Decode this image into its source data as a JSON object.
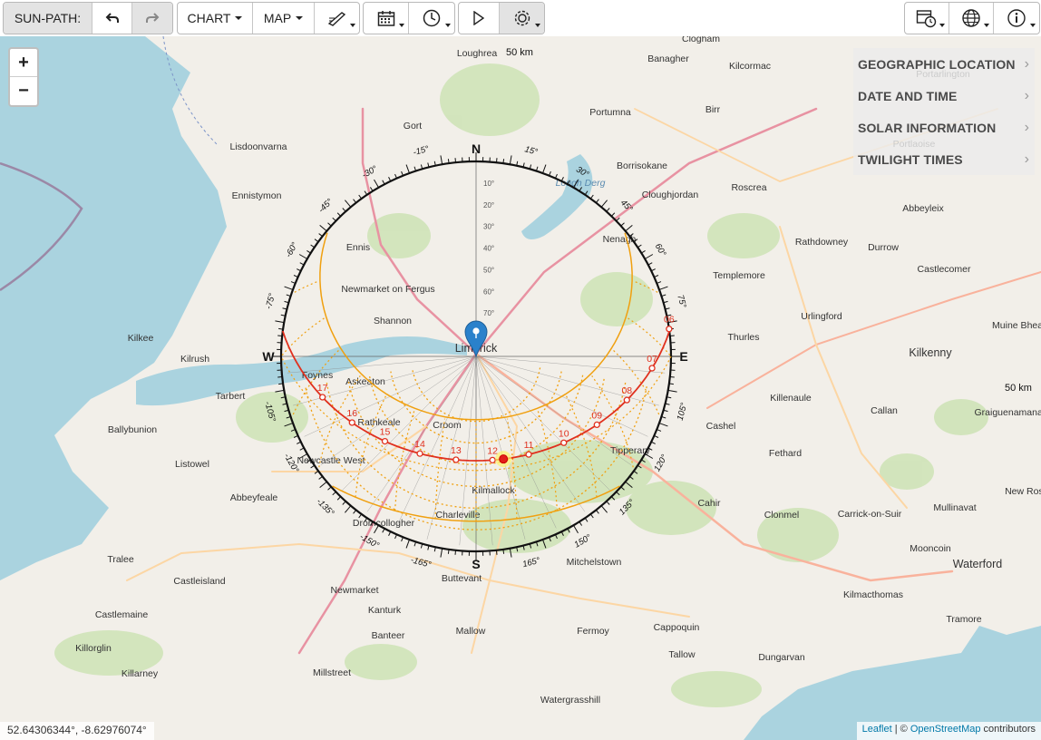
{
  "toolbar": {
    "app_label": "SUN-PATH:",
    "chart_label": "CHART",
    "map_label": "MAP",
    "icons": [
      "undo-icon",
      "redo-icon",
      "draw-icon",
      "calendar-icon",
      "clock-icon",
      "play-icon",
      "settings-icon",
      "datetime-settings-icon",
      "globe-icon",
      "info-icon"
    ]
  },
  "zoom": {
    "in": "+",
    "out": "−"
  },
  "panel": {
    "items": [
      {
        "label": "GEOGRAPHIC LOCATION"
      },
      {
        "label": "DATE AND TIME"
      },
      {
        "label": "SOLAR INFORMATION"
      },
      {
        "label": "TWILIGHT TIMES"
      }
    ],
    "chevron": "›"
  },
  "compass": {
    "north": "N",
    "south": "S",
    "east": "E",
    "west": "W",
    "azimuth_labels": [
      "15°",
      "30°",
      "45°",
      "60°",
      "75°",
      "105°",
      "120°",
      "135°",
      "150°",
      "165°",
      "-15°",
      "-30°",
      "-45°",
      "-60°",
      "-75°",
      "-105°",
      "-120°",
      "-135°",
      "-150°",
      "-165°"
    ],
    "altitude_labels": [
      "10°",
      "20°",
      "30°",
      "40°",
      "50°",
      "60°",
      "70°"
    ]
  },
  "sun_path": {
    "hours": [
      "17",
      "16",
      "15",
      "14",
      "13",
      "12",
      "11",
      "10",
      "09",
      "08",
      "07",
      "06"
    ],
    "color": "#e0301e",
    "arc_color": "#f0a010"
  },
  "map": {
    "places": [
      "Loughrea",
      "Banagher",
      "Kilcormac",
      "Clogham",
      "Portarlington",
      "Gort",
      "Portumna",
      "Birr",
      "Lisdoonvarna",
      "Borrisokane",
      "Roscrea",
      "Portlaoise",
      "Ennistymon",
      "Cloughjordan",
      "Abbeyleix",
      "Ennis",
      "Nenagh",
      "Rathdowney",
      "Durrow",
      "Castlecomer",
      "Newmarket on Fergus",
      "Templemore",
      "Shannon",
      "Urlingford",
      "Kilkee",
      "Limerick",
      "Thurles",
      "Kilkenny",
      "Muine Bheag",
      "Kilrush",
      "Askeaton",
      "Foynes",
      "Tarbert",
      "Rathkeale",
      "Killenaule",
      "Callan",
      "Graiguenamanagh",
      "Ballybunion",
      "Croom",
      "Cashel",
      "Listowel",
      "Newcastle West",
      "Tipperary",
      "Fethard",
      "Kilmallock",
      "Abbeyfeale",
      "Charleville",
      "Cahir",
      "Clonmel",
      "Carrick-on-Suir",
      "Mullinavat",
      "New Ross",
      "Dromcollogher",
      "Buttevant",
      "Mitchelstown",
      "Mooncoin",
      "Tralee",
      "Castleisland",
      "Newmarket",
      "Waterford",
      "Kanturk",
      "Kilmacthomas",
      "Castlemaine",
      "Banteer",
      "Mallow",
      "Fermoy",
      "Cappoquin",
      "Tramore",
      "Killorglin",
      "Tallow",
      "Dungarvan",
      "Killarney",
      "Millstreet",
      "Watergrasshill",
      "Lough Derg"
    ],
    "scale_top": "50 km",
    "scale_right": "50 km"
  },
  "coords": "52.64306344°, -8.62976074°",
  "attribution": {
    "leaflet": "Leaflet",
    "sep": " | © ",
    "osm": "OpenStreetMap",
    "tail": " contributors"
  }
}
